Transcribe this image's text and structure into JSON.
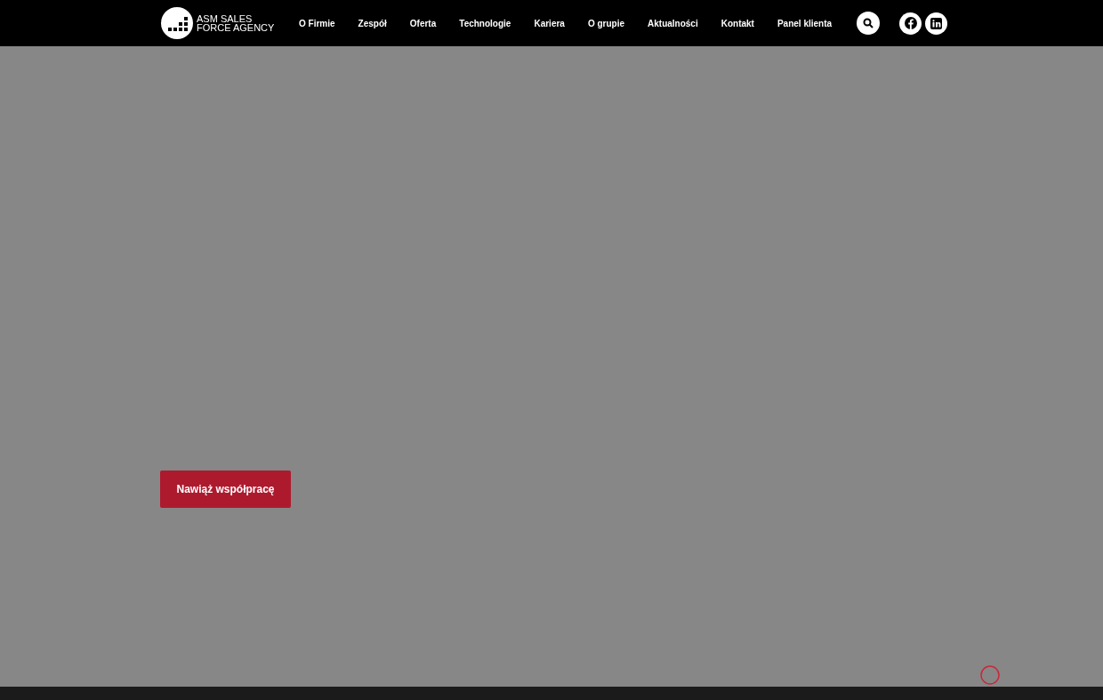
{
  "header": {
    "logo_lines": [
      "ASM SALES",
      "FORCE AGENCY"
    ],
    "nav": [
      {
        "label": "O Firmie"
      },
      {
        "label": "Zespół"
      },
      {
        "label": "Oferta"
      },
      {
        "label": "Technologie"
      },
      {
        "label": "Kariera"
      },
      {
        "label": "O grupie"
      },
      {
        "label": "Aktualności"
      },
      {
        "label": "Kontakt"
      },
      {
        "label": "Panel klienta"
      }
    ]
  },
  "hero": {
    "cta": "Nawiąż współpracę"
  }
}
